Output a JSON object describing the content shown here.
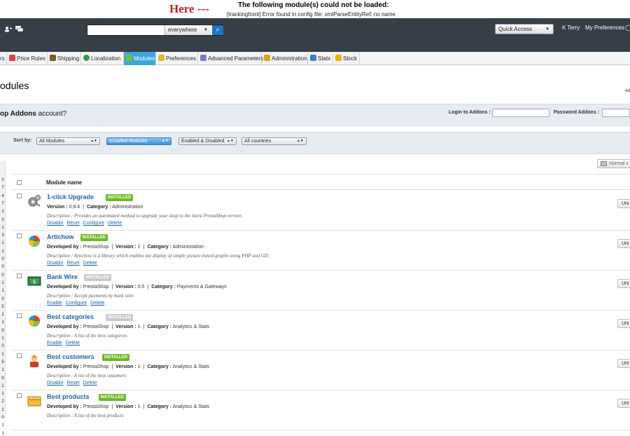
{
  "error": {
    "here": "Here ---",
    "title": "The following module(s) could not be loaded:",
    "message": "[trackingfront] Error found in config file: xmlParseEntityRef: no name"
  },
  "header": {
    "search_scope": "everywhere",
    "quick_access": "Quick Access",
    "user": "K Terry",
    "preferences_link": "My Preferences"
  },
  "tabs": [
    {
      "label": "rs",
      "color": ""
    },
    {
      "label": "Price Rules",
      "color": "#d44"
    },
    {
      "label": "Shipping",
      "color": "#7a5a2a"
    },
    {
      "label": "Localization",
      "color": "#3a9a3a"
    },
    {
      "label": "Modules",
      "color": "#6cc04a"
    },
    {
      "label": "Preferences",
      "color": "#e2b645"
    },
    {
      "label": "Advanced Parameters",
      "color": "#7a7acb"
    },
    {
      "label": "Administration",
      "color": "#d7a51c"
    },
    {
      "label": "Stats",
      "color": "#3b7fcf"
    },
    {
      "label": "Stock",
      "color": "#e9b500"
    }
  ],
  "page_title": "odules",
  "page_title_cut": "Ad",
  "addons": {
    "question_prefix": "op Addons",
    "question_suffix": " account?",
    "login_label": "Login to Addons :",
    "password_label": "Password Addons :"
  },
  "filters": {
    "sort_label": "Sort by:",
    "options": [
      "All Modules",
      "Installed Modules",
      "Enabled & Disabled",
      "All countries"
    ]
  },
  "left_numbers": [
    "0",
    "7",
    "4",
    "7",
    "1",
    "0",
    "1",
    "3",
    "1",
    "1",
    "0",
    "0",
    "0",
    "1",
    "1",
    "0",
    "5",
    "1",
    "1",
    "0",
    "1",
    "0",
    "1",
    "5",
    "1",
    "0",
    "1",
    "1",
    "2",
    "1",
    "0",
    "1",
    "1"
  ],
  "normal_view_label": "Normal v",
  "table": {
    "header": "Module name",
    "uninstall_label": "Uni",
    "rows": [
      {
        "name": "1-click Upgrade",
        "badge": "INSTALLED",
        "badge_color": "green",
        "icon": "gear-icon",
        "meta": [
          {
            "label": "Version :",
            "value": "0.9.4"
          },
          {
            "label": "Category :",
            "value": "Administration"
          }
        ],
        "description": "Description : Provides an automated method to upgrade your shop to the latest PrestaShop version",
        "actions": [
          "Disable",
          "Reset",
          "Configure",
          "Delete"
        ]
      },
      {
        "name": "Artichow",
        "badge": "INSTALLED",
        "badge_color": "green",
        "icon": "pie-chart-icon",
        "meta": [
          {
            "label": "Developed by :",
            "value": "PrestaShop"
          },
          {
            "label": "Version :",
            "value": "1"
          },
          {
            "label": "Category :",
            "value": "Administration"
          }
        ],
        "description": "Description : Artichow is a library which enables the display of simple picture-based graphs using PHP and GD.",
        "actions": [
          "Disable",
          "Reset",
          "Delete"
        ]
      },
      {
        "name": "Bank Wire",
        "badge": "INSTALLED",
        "badge_color": "grey",
        "icon": "money-icon",
        "meta": [
          {
            "label": "Developed by :",
            "value": "PrestaShop"
          },
          {
            "label": "Version :",
            "value": "0.5"
          },
          {
            "label": "Category :",
            "value": "Payments & Gateways"
          }
        ],
        "description": "Description : Accept payments by bank wire.",
        "actions": [
          "Enable",
          "Configure",
          "Delete"
        ]
      },
      {
        "name": "Best categories",
        "badge": "INSTALLED",
        "badge_color": "grey",
        "icon": "pie-chart-icon",
        "meta": [
          {
            "label": "Developed by :",
            "value": "PrestaShop"
          },
          {
            "label": "Version :",
            "value": "1"
          },
          {
            "label": "Category :",
            "value": "Analytics & Stats"
          }
        ],
        "description": "Description : A list of the best categories",
        "actions": [
          "Enable",
          "Delete"
        ]
      },
      {
        "name": "Best customers",
        "badge": "INSTALLED",
        "badge_color": "green",
        "icon": "customer-icon",
        "meta": [
          {
            "label": "Developed by :",
            "value": "PrestaShop"
          },
          {
            "label": "Version :",
            "value": "1"
          },
          {
            "label": "Category :",
            "value": "Analytics & Stats"
          }
        ],
        "description": "Description : A list of the best customers",
        "actions": [
          "Disable",
          "Reset",
          "Delete"
        ]
      },
      {
        "name": "Best products",
        "badge": "INSTALLED",
        "badge_color": "green",
        "icon": "box-icon",
        "meta": [
          {
            "label": "Developed by :",
            "value": "PrestaShop"
          },
          {
            "label": "Version :",
            "value": "1"
          },
          {
            "label": "Category :",
            "value": "Analytics & Stats"
          }
        ],
        "description": "Description : A list of the best products",
        "actions": []
      }
    ]
  }
}
